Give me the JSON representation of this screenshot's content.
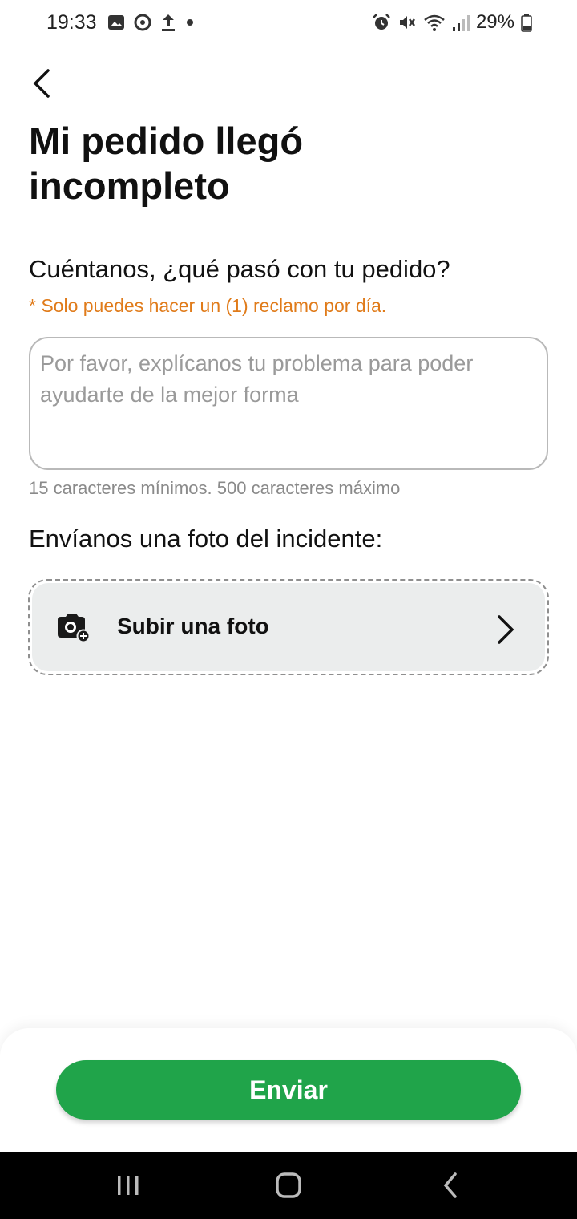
{
  "status_bar": {
    "time": "19:33",
    "battery": "29%",
    "left_icons": [
      "gallery-icon",
      "sync-icon",
      "upload-icon",
      "dot-icon"
    ],
    "right_icons": [
      "alarm-icon",
      "mute-icon",
      "wifi-icon",
      "signal-icon",
      "battery-icon"
    ]
  },
  "header": {
    "back_icon": "chevron-left-icon",
    "title": "Mi pedido llegó incompleto"
  },
  "form": {
    "question": "Cuéntanos, ¿qué pasó con tu pedido?",
    "notice": "* Solo puedes hacer un (1) reclamo por día.",
    "textarea_value": "",
    "textarea_placeholder": "Por favor, explícanos tu problema para poder ayudarte de la mejor forma",
    "char_hint": "15 caracteres mínimos. 500 caracteres máximo",
    "photo_label": "Envíanos una foto del incidente:",
    "upload_label": "Subir una foto",
    "upload_icon": "camera-add-icon"
  },
  "footer": {
    "send_label": "Enviar"
  },
  "nav_bar": {
    "items": [
      "recent-apps-icon",
      "home-icon",
      "back-icon"
    ]
  },
  "colors": {
    "accent_green": "#20a44a",
    "notice_orange": "#e07b1a"
  }
}
